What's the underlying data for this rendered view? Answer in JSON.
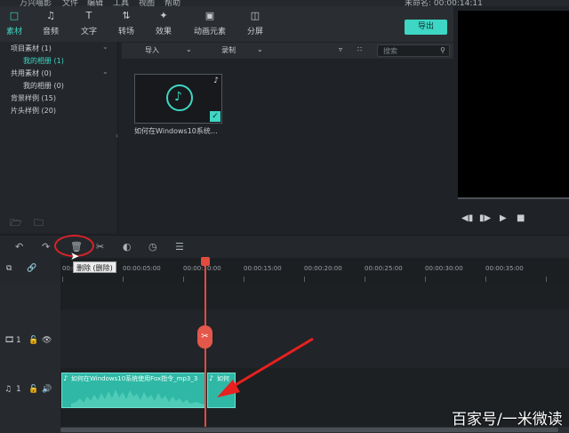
{
  "menu": {
    "items": [
      "万兴喵影",
      "文件",
      "编辑",
      "工具",
      "视图",
      "帮助"
    ],
    "title": "未命名: 00:00:14:11"
  },
  "toolbar": {
    "tabs": [
      {
        "label": "素材",
        "icon": "folder-icon"
      },
      {
        "label": "音频",
        "icon": "music-note-icon"
      },
      {
        "label": "文字",
        "icon": "text-icon"
      },
      {
        "label": "转场",
        "icon": "transition-icon"
      },
      {
        "label": "效果",
        "icon": "effects-icon"
      },
      {
        "label": "动画元素",
        "icon": "image-icon"
      },
      {
        "label": "分屏",
        "icon": "split-screen-icon"
      }
    ],
    "export_label": "导出",
    "accent_color": "#3ed6c4"
  },
  "sidebar": {
    "items": [
      {
        "label": "项目素材 (1)"
      },
      {
        "label": "我的相册 (1)"
      },
      {
        "label": "共用素材 (0)"
      },
      {
        "label": "我的相册 (0)"
      },
      {
        "label": "背景样例 (15)"
      },
      {
        "label": "片头样例 (20)"
      }
    ]
  },
  "media": {
    "import_label": "导入",
    "record_label": "录制",
    "search_placeholder": "搜索",
    "tile_caption": "如何在Windows10系统…"
  },
  "timeline": {
    "ruler": [
      "00:00:00:00",
      "00:00:05:00",
      "00:00:10:00",
      "00:00:15:00",
      "00:00:20:00",
      "00:00:25:00",
      "00:00:30:00",
      "00:00:35:00"
    ],
    "tooltip": "删除 (删除)",
    "video_track_num": "1",
    "audio_track_num": "1",
    "clip_label": "如何在Windows10系统使用Fox指令_mp3_3",
    "clip2_label": "如何"
  },
  "watermark": "百家号/一米微读"
}
